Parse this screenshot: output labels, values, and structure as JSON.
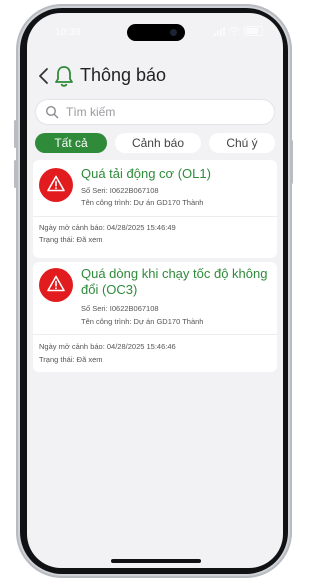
{
  "status": {
    "time": "10:39"
  },
  "header": {
    "title": "Thông báo"
  },
  "search": {
    "placeholder": "Tìm kiếm"
  },
  "tabs": [
    {
      "label": "Tất cả",
      "active": true
    },
    {
      "label": "Cảnh báo",
      "active": false
    },
    {
      "label": "Chú ý",
      "active": false
    }
  ],
  "alerts": [
    {
      "title": "Quá tải động cơ (OL1)",
      "serial": "Số Seri: I0622B067108",
      "project": "Tên công trình: Dự án GD170 Thành",
      "opened": "Ngày mở cảnh báo: 04/28/2025 15:46:49",
      "state": "Trạng thái: Đã xem"
    },
    {
      "title": "Quá dòng khi chạy tốc độ không đổi (OC3)",
      "serial": "Số Seri: I0622B067108",
      "project": "Tên công trình: Dự án GD170 Thành",
      "opened": "Ngày mở cảnh báo: 04/28/2025 15:46:46",
      "state": "Trạng thái: Đã xem"
    }
  ],
  "colors": {
    "accent": "#2f8a3a",
    "alert_red": "#e21b1f",
    "title_green": "#2e8b3a"
  },
  "icons": [
    "back-chevron-icon",
    "bell-icon",
    "search-icon",
    "warning-icon"
  ]
}
